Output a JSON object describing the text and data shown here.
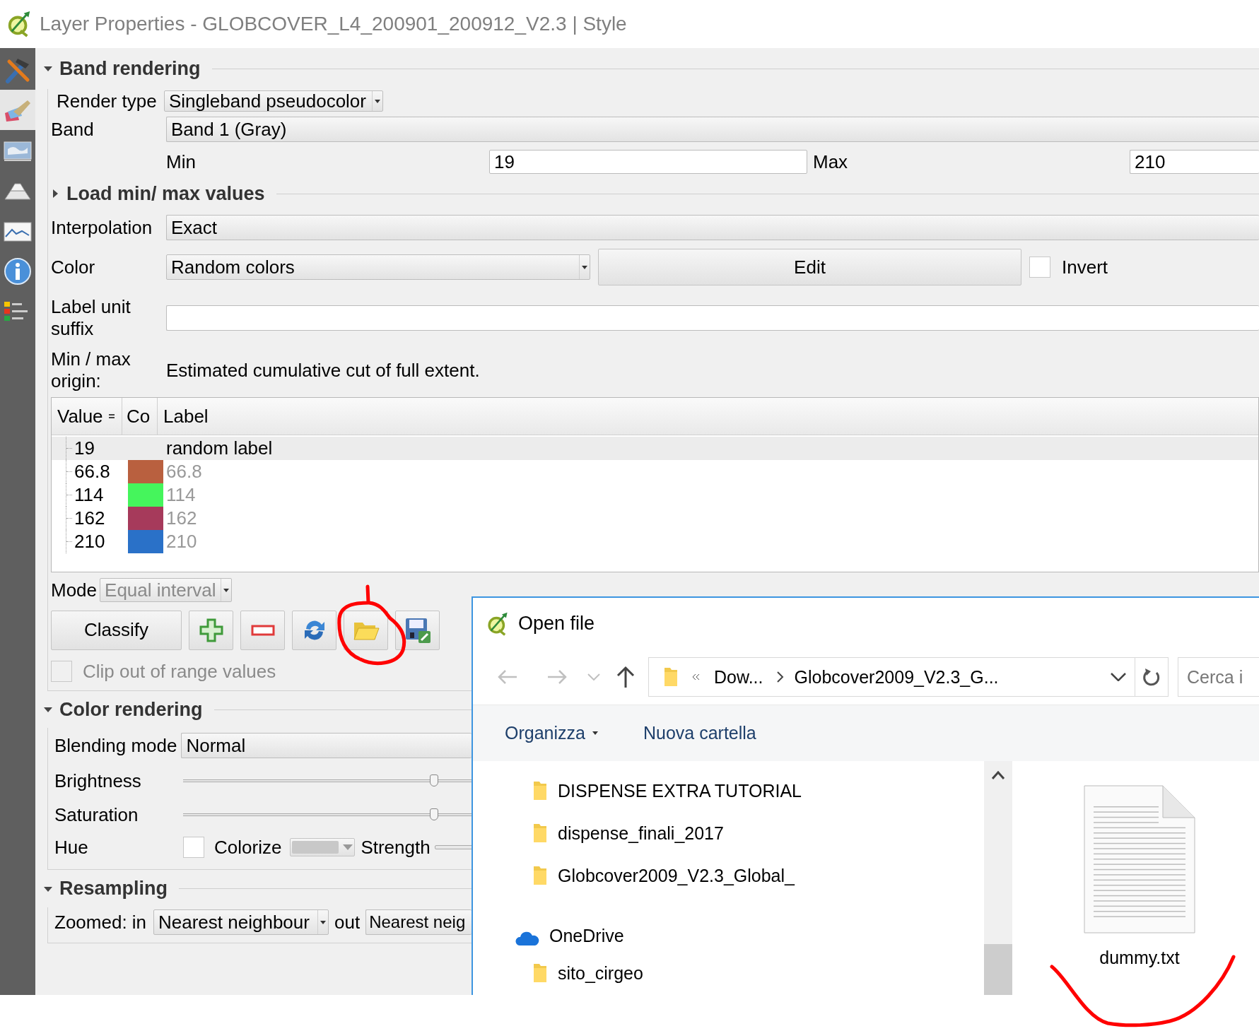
{
  "window": {
    "title": "Layer Properties - GLOBCOVER_L4_200901_200912_V2.3 | Style"
  },
  "sidebar": {
    "items": [
      {
        "kind": "tools",
        "selected": false
      },
      {
        "kind": "style",
        "selected": true
      },
      {
        "kind": "picture",
        "selected": false
      },
      {
        "kind": "pyramid",
        "selected": false
      },
      {
        "kind": "histogram",
        "selected": false
      },
      {
        "kind": "info",
        "selected": false
      },
      {
        "kind": "legend",
        "selected": false
      }
    ]
  },
  "band_rendering": {
    "title": "Band rendering",
    "expanded": true,
    "render_type": {
      "label": "Render type",
      "value": "Singleband pseudocolor"
    },
    "band": {
      "label": "Band",
      "value": "Band 1 (Gray)"
    },
    "min": {
      "label": "Min",
      "value": "19"
    },
    "max": {
      "label": "Max",
      "value": "210"
    },
    "load_minmax": {
      "title": "Load min/ max values",
      "expanded": false
    },
    "interpolation": {
      "label": "Interpolation",
      "value": "Exact"
    },
    "color": {
      "label": "Color",
      "value": "Random colors"
    },
    "edit_button": "Edit",
    "invert": {
      "label": "Invert",
      "checked": false
    },
    "label_suffix": {
      "label": "Label unit suffix"
    },
    "minmax_origin": {
      "label": "Min / max origin:",
      "value": "Estimated cumulative cut of full extent."
    },
    "table": {
      "columns": [
        "Value",
        "Co",
        "Label"
      ],
      "rows": [
        {
          "value": "19",
          "label": "random label",
          "default_label": false,
          "selected": true
        },
        {
          "value": "66.8",
          "color": "#b9603f",
          "label": "66.8",
          "default_label": true,
          "selected": false
        },
        {
          "value": "114",
          "color": "#45f55c",
          "label": "114",
          "default_label": true,
          "selected": false
        },
        {
          "value": "162",
          "color": "#a63a5b",
          "label": "162",
          "default_label": true,
          "selected": false
        },
        {
          "value": "210",
          "color": "#2a71c8",
          "label": "210",
          "default_label": true,
          "selected": false
        }
      ]
    },
    "mode": {
      "label": "Mode",
      "value": "Equal interval",
      "disabled": true
    },
    "classify_button": "Classify",
    "tool_buttons": [
      {
        "kind": "add"
      },
      {
        "kind": "remove"
      },
      {
        "kind": "refresh"
      },
      {
        "kind": "open"
      },
      {
        "kind": "save"
      }
    ],
    "clip": {
      "label": "Clip out of range values",
      "checked": false,
      "disabled": true
    }
  },
  "color_rendering": {
    "title": "Color rendering",
    "expanded": true,
    "blending_mode": {
      "label": "Blending mode",
      "value": "Normal"
    },
    "brightness": {
      "label": "Brightness",
      "level": 0.5
    },
    "saturation": {
      "label": "Saturation",
      "level": 0.5
    },
    "hue": {
      "label": "Hue"
    },
    "colorize": {
      "label": "Colorize",
      "checked": false
    },
    "strength": {
      "label": "Strength"
    }
  },
  "resampling": {
    "title": "Resampling",
    "expanded": true,
    "zoomed_in_label": "Zoomed: in",
    "zoomed_in": "Nearest neighbour",
    "zoomed_out_label": "out",
    "zoomed_out": "Nearest neig"
  },
  "open_file_dialog": {
    "title": "Open file",
    "back": {
      "disabled": true
    },
    "forward": {
      "disabled": true
    },
    "path": [
      "Dow...",
      "Globcover2009_V2.3_G..."
    ],
    "search": {
      "placeholder": "Cerca i"
    },
    "toolbar": [
      {
        "kind": "menu",
        "label": "Organizza"
      },
      {
        "kind": "button",
        "label": "Nuova cartella"
      }
    ],
    "tree": [
      {
        "children": [
          {
            "kind": "folder",
            "label": "DISPENSE EXTRA TUTORIAL"
          },
          {
            "kind": "folder",
            "label": "dispense_finali_2017"
          },
          {
            "kind": "folder",
            "label": "Globcover2009_V2.3_Global_"
          }
        ]
      },
      {
        "kind": "cloud",
        "label": "OneDrive",
        "children": [
          {
            "kind": "folder",
            "label": "sito_cirgeo"
          }
        ]
      }
    ],
    "files": [
      {
        "kind": "text",
        "name": "dummy.txt"
      }
    ]
  }
}
